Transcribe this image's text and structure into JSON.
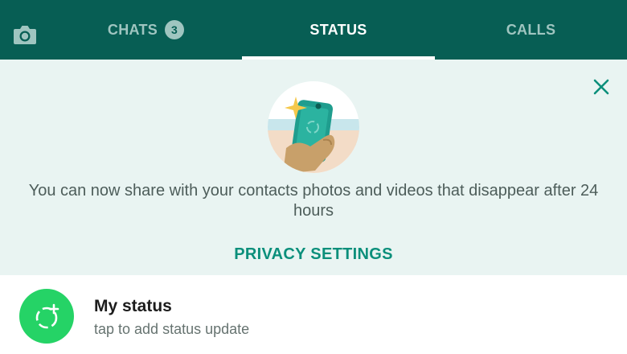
{
  "header": {
    "camera_icon": "camera-icon",
    "tabs": [
      {
        "label": "CHATS",
        "badge": "3",
        "active": false
      },
      {
        "label": "STATUS",
        "active": true
      },
      {
        "label": "CALLS",
        "active": false
      }
    ]
  },
  "banner": {
    "close_icon": "close-icon",
    "illustration": "phone-in-hand-illustration",
    "message": "You can now share with your contacts photos and videos that disappear after 24 hours",
    "link_label": "PRIVACY SETTINGS"
  },
  "my_status": {
    "avatar_icon": "add-status-icon",
    "title": "My status",
    "subtitle": "tap to add status update"
  },
  "colors": {
    "header_bg": "#075e54",
    "accent": "#0b8f7b",
    "banner_bg": "#e9f4f2",
    "avatar_bg": "#25d366"
  }
}
